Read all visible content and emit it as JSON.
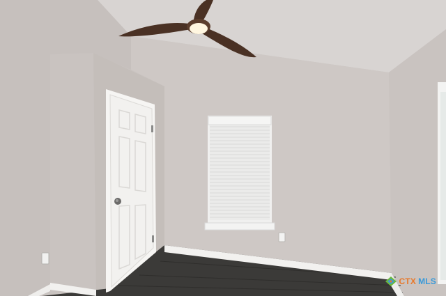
{
  "scene": {
    "description_free": true,
    "colors": {
      "wall_main": "#cdc7c4",
      "wall_left": "#c3bdba",
      "wall_right": "#c6c0bd",
      "ceiling": "#d7d3d1",
      "floor": "#3a3937",
      "baseboard": "#f2f1ef",
      "door": "#f4f3f1",
      "blind": "#ececeb",
      "fan_blade": "#4a3124",
      "fan_light": "#fff4dc"
    }
  },
  "watermark": {
    "brand_left": "CTX",
    "brand_right": "MLS",
    "accent_orange": "#e8792b",
    "accent_blue": "#3a9ad9",
    "accent_green": "#6cb83c"
  }
}
